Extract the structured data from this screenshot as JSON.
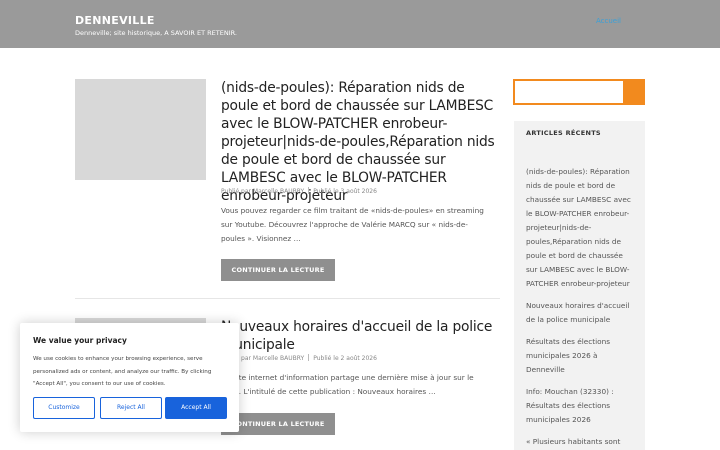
{
  "site": {
    "title": "DENNEVILLE",
    "description": "Denneville; site historique, A SAVOIR ET RETENIR.",
    "menu_link": "Accueil"
  },
  "posts": [
    {
      "title": "(nids-de-poules): Réparation nids de poule et bord de chaussée sur LAMBESC avec le BLOW-PATCHER enrobeur-projeteur|nids-de-poules,Réparation nids de poule et bord de chaussée sur LAMBESC avec le BLOW-PATCHER enrobeur-projeteur",
      "author": "Publié par Marcelle BAUBRY",
      "date": "Publié le 3 août 2026",
      "excerpt": "Vous pouvez regarder ce film traitant de «nids-de-poules» en streaming sur Youtube. Découvrez l'approche de Valérie MARCQ sur « nids-de-poules ». Visionnez …",
      "button": "CONTINUER LA LECTURE"
    },
    {
      "title": "Nouveaux horaires d'accueil de la police municipale",
      "author": "Publié par Marcelle BAUBRY",
      "date": "Publié le 2 août 2026",
      "excerpt": "Ce site internet d'information partage une dernière mise à jour sur le sujet. L'intitulé de cette publication : Nouveaux horaires …",
      "button": "CONTINUER LA LECTURE"
    }
  ],
  "sidebar": {
    "search_placeholder": "",
    "recent_title": "ARTICLES RÉCENTS",
    "recent_items": [
      "(nids-de-poules): Réparation nids de poule et bord de chaussée sur LAMBESC avec le BLOW-PATCHER enrobeur-projeteur|nids-de-poules,Réparation nids de poule et bord de chaussée sur LAMBESC avec le BLOW-PATCHER enrobeur-projeteur",
      "Nouveaux horaires d'accueil de la police municipale",
      "Résultats des élections municipales 2026 à Denneville",
      "Info: Mouchan (32330) : Résultats des élections municipales 2026",
      "« Plusieurs habitants sont"
    ]
  },
  "cookie": {
    "title": "We value your privacy",
    "text": "We use cookies to enhance your browsing experience, serve personalized ads or content, and analyze our traffic. By clicking \"Accept All\", you consent to our use of cookies.",
    "customize": "Customize",
    "reject": "Reject All",
    "accept": "Accept All"
  },
  "colors": {
    "header_bg": "#9a9a9a",
    "accent_orange": "#f28a1e",
    "button_gray": "#8f8f8f",
    "cookie_blue": "#1863dc"
  }
}
